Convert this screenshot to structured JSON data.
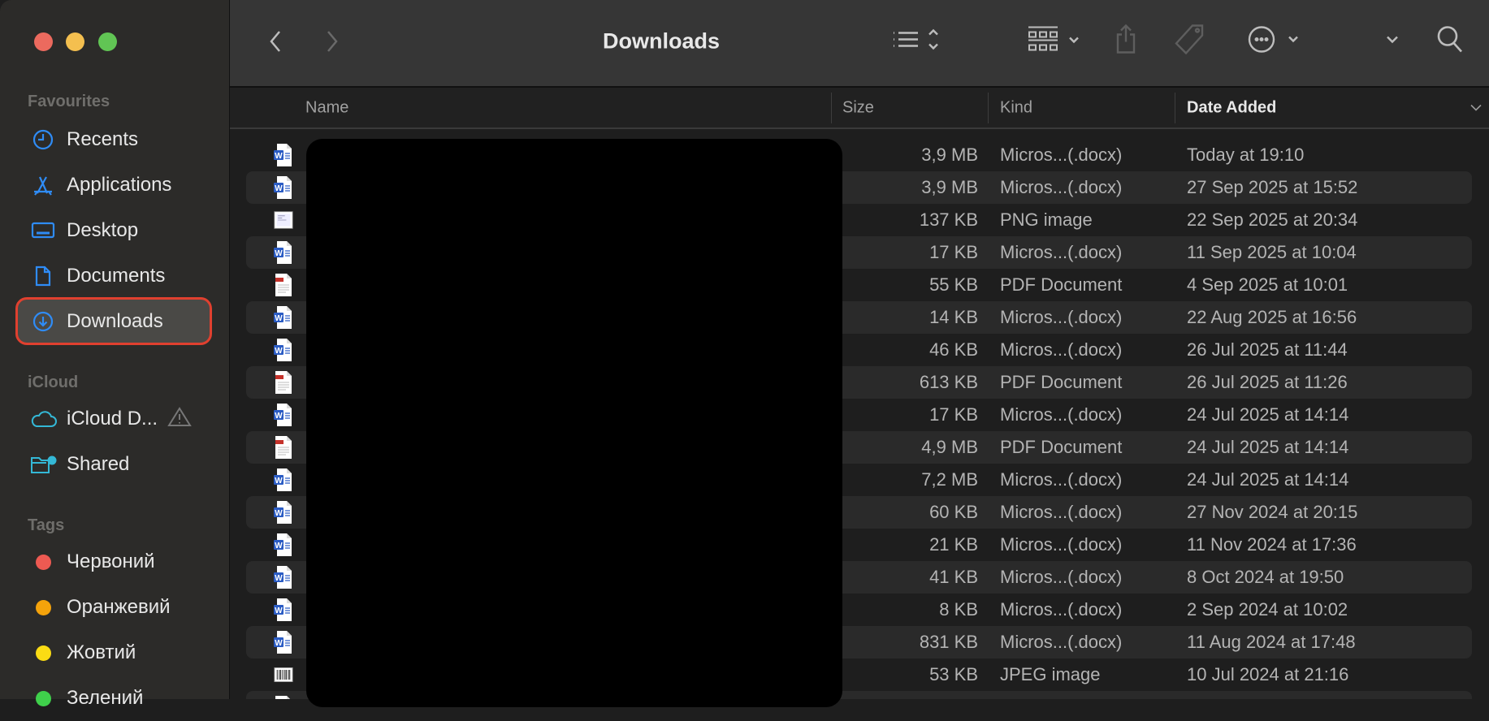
{
  "window": {
    "traffic_lights": {
      "close": "#ec6a5e",
      "minimize": "#f4bf4f",
      "zoom": "#61c554"
    }
  },
  "sidebar": {
    "favourites_label": "Favourites",
    "favourites": [
      {
        "label": "Recents",
        "icon": "clock-icon"
      },
      {
        "label": "Applications",
        "icon": "applications-icon"
      },
      {
        "label": "Desktop",
        "icon": "desktop-icon"
      },
      {
        "label": "Documents",
        "icon": "document-icon"
      },
      {
        "label": "Downloads",
        "icon": "download-icon",
        "selected": true
      }
    ],
    "icloud_label": "iCloud",
    "icloud": [
      {
        "label": "iCloud D...",
        "icon": "cloud-icon",
        "warning": true
      },
      {
        "label": "Shared",
        "icon": "shared-folder-icon"
      }
    ],
    "tags_label": "Tags",
    "tags": [
      {
        "label": "Червоний",
        "color": "#ee5a52"
      },
      {
        "label": "Оранжевий",
        "color": "#f5a30b"
      },
      {
        "label": "Жовтий",
        "color": "#fbdc14"
      },
      {
        "label": "Зелений",
        "color": "#3fd04b"
      }
    ]
  },
  "toolbar": {
    "title": "Downloads"
  },
  "columns": {
    "name": "Name",
    "size": "Size",
    "kind": "Kind",
    "date": "Date Added"
  },
  "files": [
    {
      "type": "docx",
      "size": "3,9 MB",
      "kind": "Micros...(.docx)",
      "date": "Today at 19:10"
    },
    {
      "type": "docx",
      "size": "3,9 MB",
      "kind": "Micros...(.docx)",
      "date": "27 Sep 2025 at 15:52"
    },
    {
      "type": "png",
      "size": "137 KB",
      "kind": "PNG image",
      "date": "22 Sep 2025 at 20:34"
    },
    {
      "type": "docx",
      "size": "17 KB",
      "kind": "Micros...(.docx)",
      "date": "11 Sep 2025 at 10:04"
    },
    {
      "type": "pdf",
      "size": "55 KB",
      "kind": "PDF Document",
      "date": "4 Sep 2025 at 10:01"
    },
    {
      "type": "docx",
      "size": "14 KB",
      "kind": "Micros...(.docx)",
      "date": "22 Aug 2025 at 16:56"
    },
    {
      "type": "docx",
      "size": "46 KB",
      "kind": "Micros...(.docx)",
      "date": "26 Jul 2025 at 11:44"
    },
    {
      "type": "pdf",
      "size": "613 KB",
      "kind": "PDF Document",
      "date": "26 Jul 2025 at 11:26"
    },
    {
      "type": "docx",
      "size": "17 KB",
      "kind": "Micros...(.docx)",
      "date": "24 Jul 2025 at 14:14"
    },
    {
      "type": "pdf",
      "size": "4,9 MB",
      "kind": "PDF Document",
      "date": "24 Jul 2025 at 14:14"
    },
    {
      "type": "docx",
      "size": "7,2 MB",
      "kind": "Micros...(.docx)",
      "date": "24 Jul 2025 at 14:14"
    },
    {
      "type": "docx",
      "size": "60 KB",
      "kind": "Micros...(.docx)",
      "date": "27 Nov 2024 at 20:15"
    },
    {
      "type": "docx",
      "size": "21 KB",
      "kind": "Micros...(.docx)",
      "date": "11 Nov 2024 at 17:36"
    },
    {
      "type": "docx",
      "size": "41 KB",
      "kind": "Micros...(.docx)",
      "date": "8 Oct 2024 at 19:50"
    },
    {
      "type": "docx",
      "size": "8 KB",
      "kind": "Micros...(.docx)",
      "date": "2 Sep 2024 at 10:02"
    },
    {
      "type": "docx",
      "size": "831 KB",
      "kind": "Micros...(.docx)",
      "date": "11 Aug 2024 at 17:48"
    },
    {
      "type": "jpeg",
      "size": "53 KB",
      "kind": "JPEG image",
      "date": "10 Jul 2024 at 21:16"
    },
    {
      "type": "pdf"
    }
  ]
}
